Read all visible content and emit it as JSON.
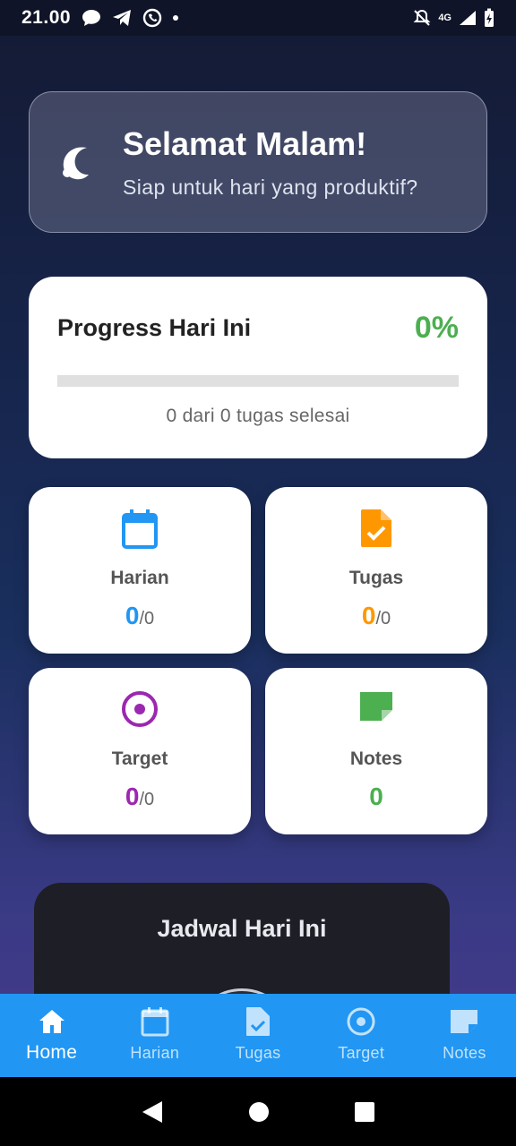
{
  "status_bar": {
    "time": "21.00",
    "network": "4G"
  },
  "greeting": {
    "title": "Selamat Malam!",
    "subtitle": "Siap untuk hari yang produktif?",
    "icon": "moon-icon"
  },
  "progress": {
    "title": "Progress Hari Ini",
    "percent_text": "0%",
    "percent": 0,
    "caption": "0 dari 0 tugas selesai",
    "color": "#4caf50"
  },
  "stats": [
    {
      "label": "Harian",
      "value": "0",
      "total": "/0",
      "color": "#2196f3",
      "icon": "calendar-icon"
    },
    {
      "label": "Tugas",
      "value": "0",
      "total": "/0",
      "color": "#ff9800",
      "icon": "task-file-icon"
    },
    {
      "label": "Target",
      "value": "0",
      "total": "/0",
      "color": "#9c27b0",
      "icon": "target-icon"
    },
    {
      "label": "Notes",
      "value": "0",
      "total": "",
      "color": "#4caf50",
      "icon": "note-icon"
    }
  ],
  "schedule": {
    "title": "Jadwal Hari Ini"
  },
  "bottom_nav": {
    "active": "Home",
    "items": [
      {
        "label": "Home",
        "icon": "home-icon"
      },
      {
        "label": "Harian",
        "icon": "calendar-icon"
      },
      {
        "label": "Tugas",
        "icon": "task-file-icon"
      },
      {
        "label": "Target",
        "icon": "target-icon"
      },
      {
        "label": "Notes",
        "icon": "note-icon"
      }
    ]
  },
  "colors": {
    "accent": "#2196f3"
  }
}
